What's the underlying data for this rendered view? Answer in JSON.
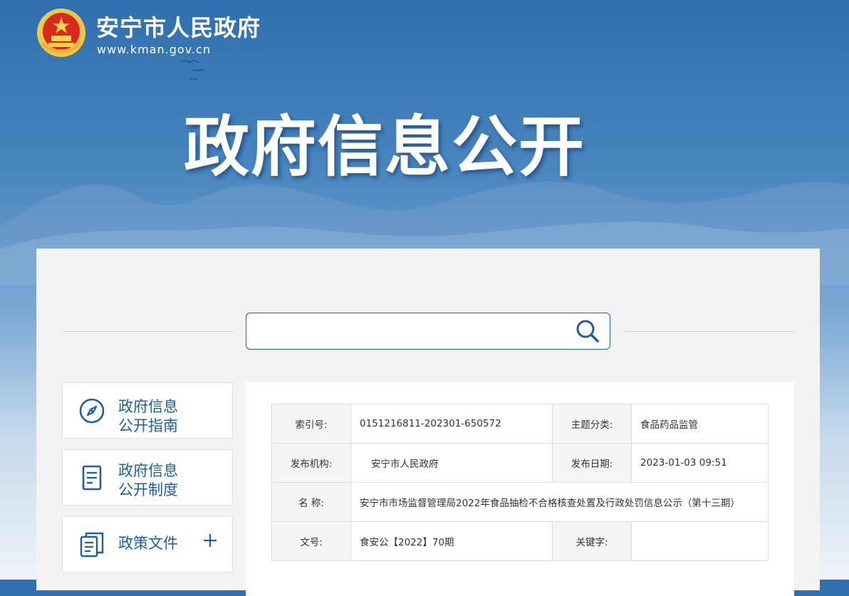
{
  "header": {
    "site_name": "安宁市人民政府",
    "site_url": "www.kman.gov.cn",
    "hero_title": "政府信息公开",
    "emblem_icon": "national-emblem-icon"
  },
  "search": {
    "value": "",
    "placeholder": "",
    "button_icon": "search-icon"
  },
  "sidebar": {
    "items": [
      {
        "label_line1": "政府信息",
        "label_line2": "公开指南",
        "icon": "compass-icon"
      },
      {
        "label_line1": "政府信息",
        "label_line2": "公开制度",
        "icon": "document-icon"
      },
      {
        "label_line1": "政策文件",
        "label_line2": "",
        "icon": "files-icon",
        "expand_icon": "plus-icon"
      }
    ]
  },
  "meta_table": {
    "rows": [
      {
        "label_a": "索引号:",
        "value_a": "0151216811-202301-650572",
        "label_b": "主题分类:",
        "value_b": "食品药品监管"
      },
      {
        "label_a": "发布机构:",
        "value_a": "安宁市人民政府",
        "label_b": "发布日期:",
        "value_b": "2023-01-03 09:51"
      },
      {
        "label_a": "名 称:",
        "value_full": "安宁市市场监督管理局2022年食品抽检不合格核查处置及行政处罚信息公示（第十三期）"
      },
      {
        "label_a": "文号:",
        "value_a": "食安公【2022】70期",
        "label_b": "关键字:",
        "value_b": ""
      }
    ]
  },
  "colors": {
    "brand_blue": "#1f5f9e",
    "banner_top": "#2f6fae",
    "panel_bg": "#f3f3f3"
  }
}
